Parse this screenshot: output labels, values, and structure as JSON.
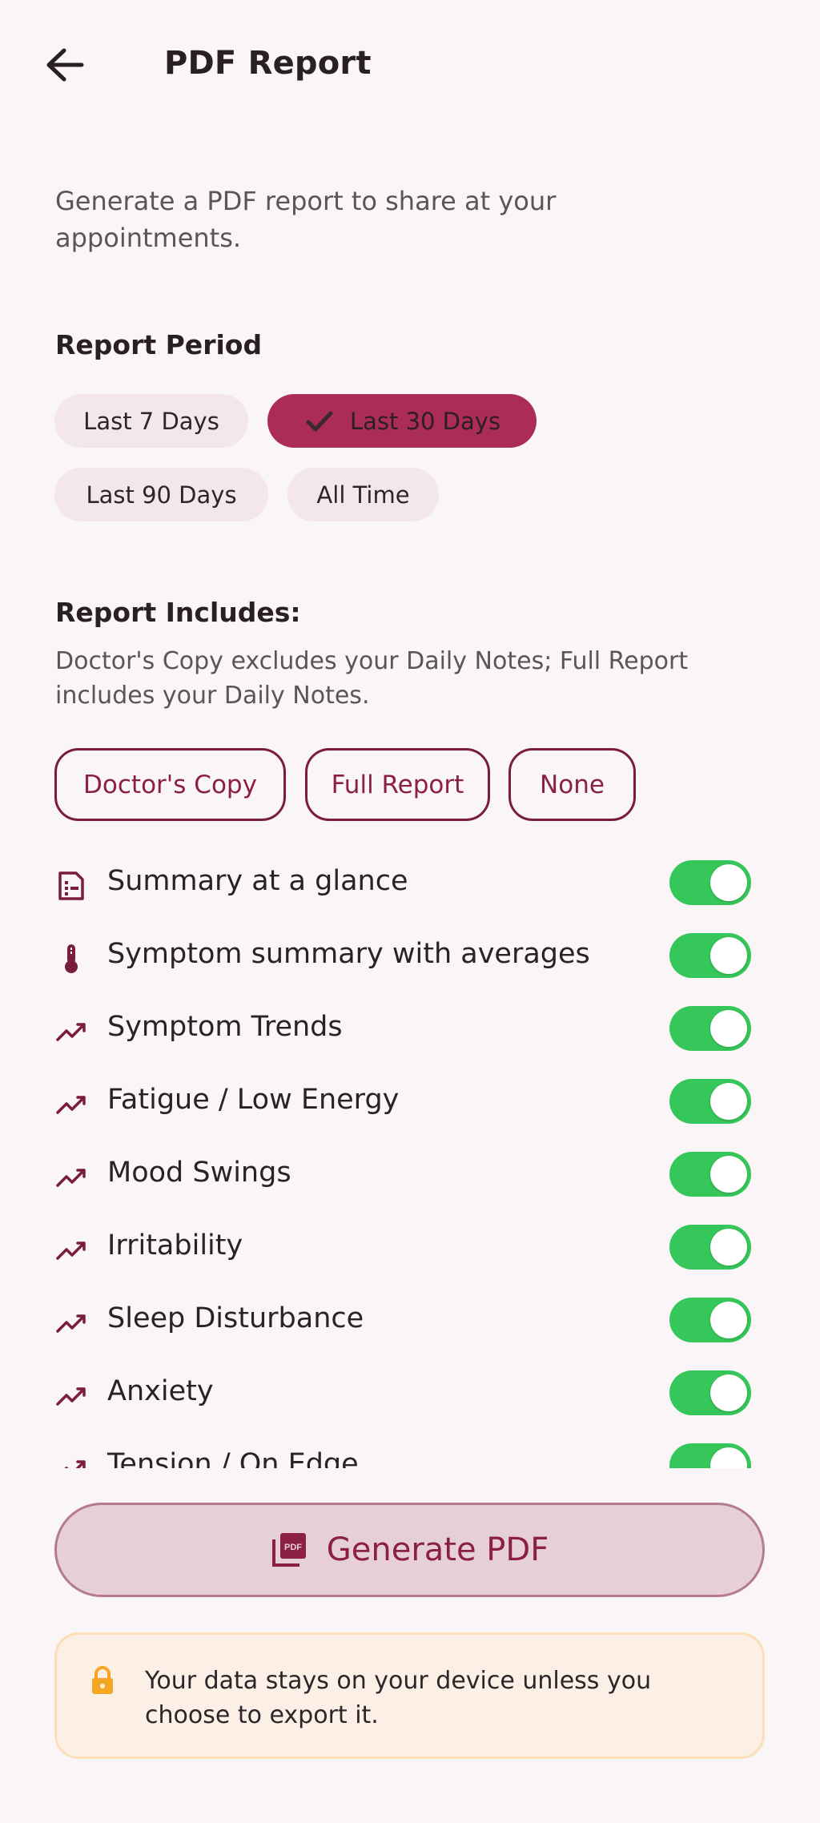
{
  "header": {
    "title": "PDF Report"
  },
  "description": "Generate a PDF report to share at your appointments.",
  "report_period": {
    "title": "Report Period",
    "options": [
      {
        "label": "Last 7 Days",
        "selected": false
      },
      {
        "label": "Last 30 Days",
        "selected": true
      },
      {
        "label": "Last 90 Days",
        "selected": false
      },
      {
        "label": "All Time",
        "selected": false
      }
    ]
  },
  "report_includes": {
    "title": "Report Includes:",
    "description": "Doctor's Copy excludes your Daily Notes; Full Report includes your Daily Notes.",
    "presets": [
      "Doctor's Copy",
      "Full Report",
      "None"
    ],
    "items": [
      {
        "label": "Summary at a glance",
        "icon": "summary-icon",
        "enabled": true
      },
      {
        "label": "Symptom summary with averages",
        "icon": "thermometer-icon",
        "enabled": true
      },
      {
        "label": "Symptom Trends",
        "icon": "trend-icon",
        "enabled": true
      },
      {
        "label": "Fatigue / Low Energy",
        "icon": "trend-icon",
        "enabled": true
      },
      {
        "label": "Mood Swings",
        "icon": "trend-icon",
        "enabled": true
      },
      {
        "label": "Irritability",
        "icon": "trend-icon",
        "enabled": true
      },
      {
        "label": "Sleep Disturbance",
        "icon": "trend-icon",
        "enabled": true
      },
      {
        "label": "Anxiety",
        "icon": "trend-icon",
        "enabled": true
      },
      {
        "label": "Tension / On Edge",
        "icon": "trend-icon",
        "enabled": true
      }
    ]
  },
  "generate_button": {
    "label": "Generate PDF",
    "icon": "pdf-icon"
  },
  "info": {
    "text": "Your data stays on your device unless you choose to export it.",
    "icon": "lock-icon"
  },
  "colors": {
    "accent": "#ab2d55",
    "brand": "#8b1f44",
    "toggle_on": "#36c75a",
    "info_bg": "#fbefe6",
    "lock": "#f5a623"
  }
}
